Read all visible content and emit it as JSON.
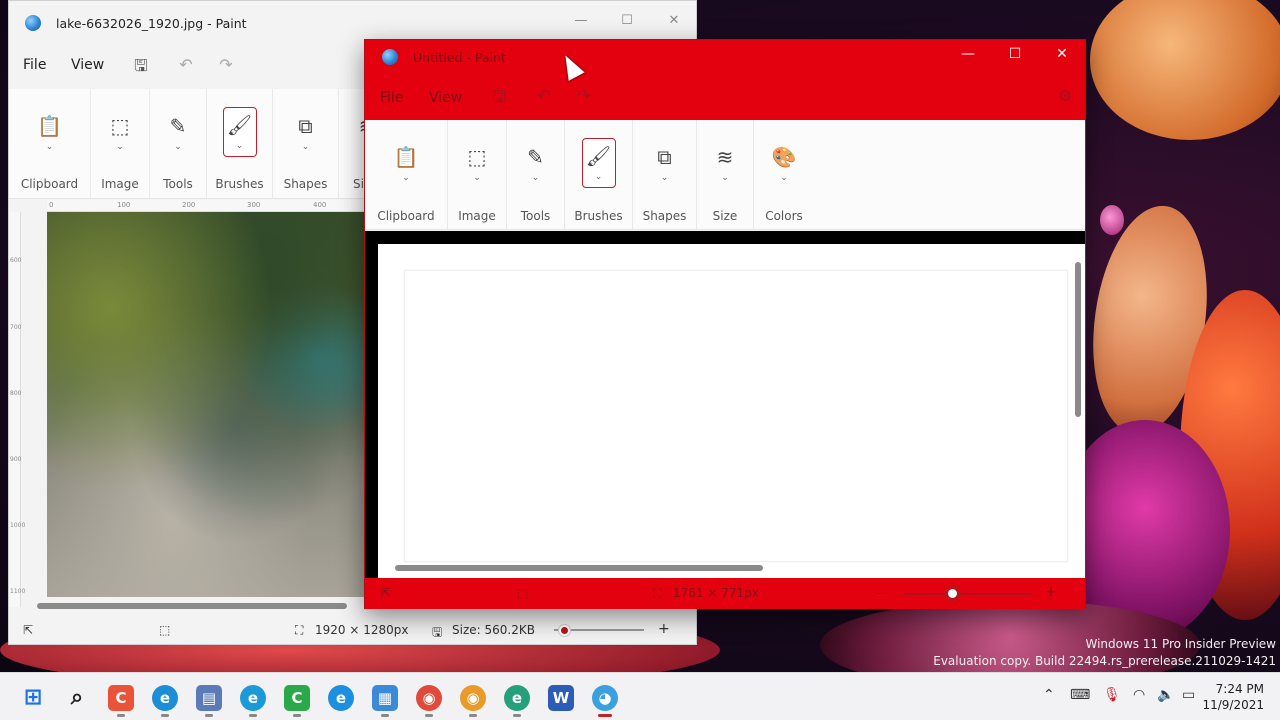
{
  "back_window": {
    "title": "lake-6632026_1920.jpg - Paint",
    "menu": {
      "file": "File",
      "view": "View"
    },
    "ribbon": [
      {
        "label": "Clipboard",
        "icon": "clipboard-icon"
      },
      {
        "label": "Image",
        "icon": "selection-icon"
      },
      {
        "label": "Tools",
        "icon": "tools-icon"
      },
      {
        "label": "Brushes",
        "icon": "brush-icon"
      },
      {
        "label": "Shapes",
        "icon": "shapes-icon"
      },
      {
        "label": "Si",
        "icon": "size-icon"
      }
    ],
    "ruler_h": [
      "0",
      "100",
      "200",
      "300",
      "400"
    ],
    "ruler_v": [
      "600",
      "700",
      "800",
      "900",
      "1000",
      "1100"
    ],
    "status": {
      "dimensions": "1920 × 1280px",
      "size": "Size: 560.2KB"
    }
  },
  "front_window": {
    "title": "Untitled - Paint",
    "menu": {
      "file": "File",
      "view": "View"
    },
    "ribbon": [
      {
        "label": "Clipboard",
        "icon": "clipboard-icon"
      },
      {
        "label": "Image",
        "icon": "selection-icon"
      },
      {
        "label": "Tools",
        "icon": "tools-icon"
      },
      {
        "label": "Brushes",
        "icon": "brush-icon"
      },
      {
        "label": "Shapes",
        "icon": "shapes-icon"
      },
      {
        "label": "Size",
        "icon": "size-icon"
      },
      {
        "label": "Colors",
        "icon": "palette-icon"
      }
    ],
    "status": {
      "dimensions": "1761 × 771px"
    },
    "accent": "#e3000f"
  },
  "watermark": {
    "line1": "Windows 11 Pro Insider Preview",
    "line2": "Evaluation copy. Build 22494.rs_prerelease.211029-1421"
  },
  "taskbar": {
    "apps": [
      {
        "name": "start",
        "glyph": "⊞",
        "color": "#1a73e8"
      },
      {
        "name": "search",
        "glyph": "⌕",
        "color": "#222222"
      },
      {
        "name": "app-red",
        "glyph": "C",
        "color": "#e8533a"
      },
      {
        "name": "edge-dev",
        "glyph": "e",
        "color": "#1b8ed6"
      },
      {
        "name": "app-printer",
        "glyph": "▤",
        "color": "#5a7ab8"
      },
      {
        "name": "edge-beta",
        "glyph": "e",
        "color": "#1c9ad8"
      },
      {
        "name": "camtasia",
        "glyph": "C",
        "color": "#2aa84a"
      },
      {
        "name": "edge",
        "glyph": "e",
        "color": "#1d8fe0"
      },
      {
        "name": "notepad",
        "glyph": "▦",
        "color": "#3a8ad8"
      },
      {
        "name": "chrome",
        "glyph": "◉",
        "color": "#e04a3a"
      },
      {
        "name": "chrome-canary",
        "glyph": "◉",
        "color": "#e89a2a"
      },
      {
        "name": "edge-canary",
        "glyph": "e",
        "color": "#25a07a"
      },
      {
        "name": "word",
        "glyph": "W",
        "color": "#2b5cb8"
      },
      {
        "name": "paint",
        "glyph": "◕",
        "color": "#3aa0e0"
      }
    ],
    "time": "7:24 PM",
    "date": "11/9/2021"
  }
}
